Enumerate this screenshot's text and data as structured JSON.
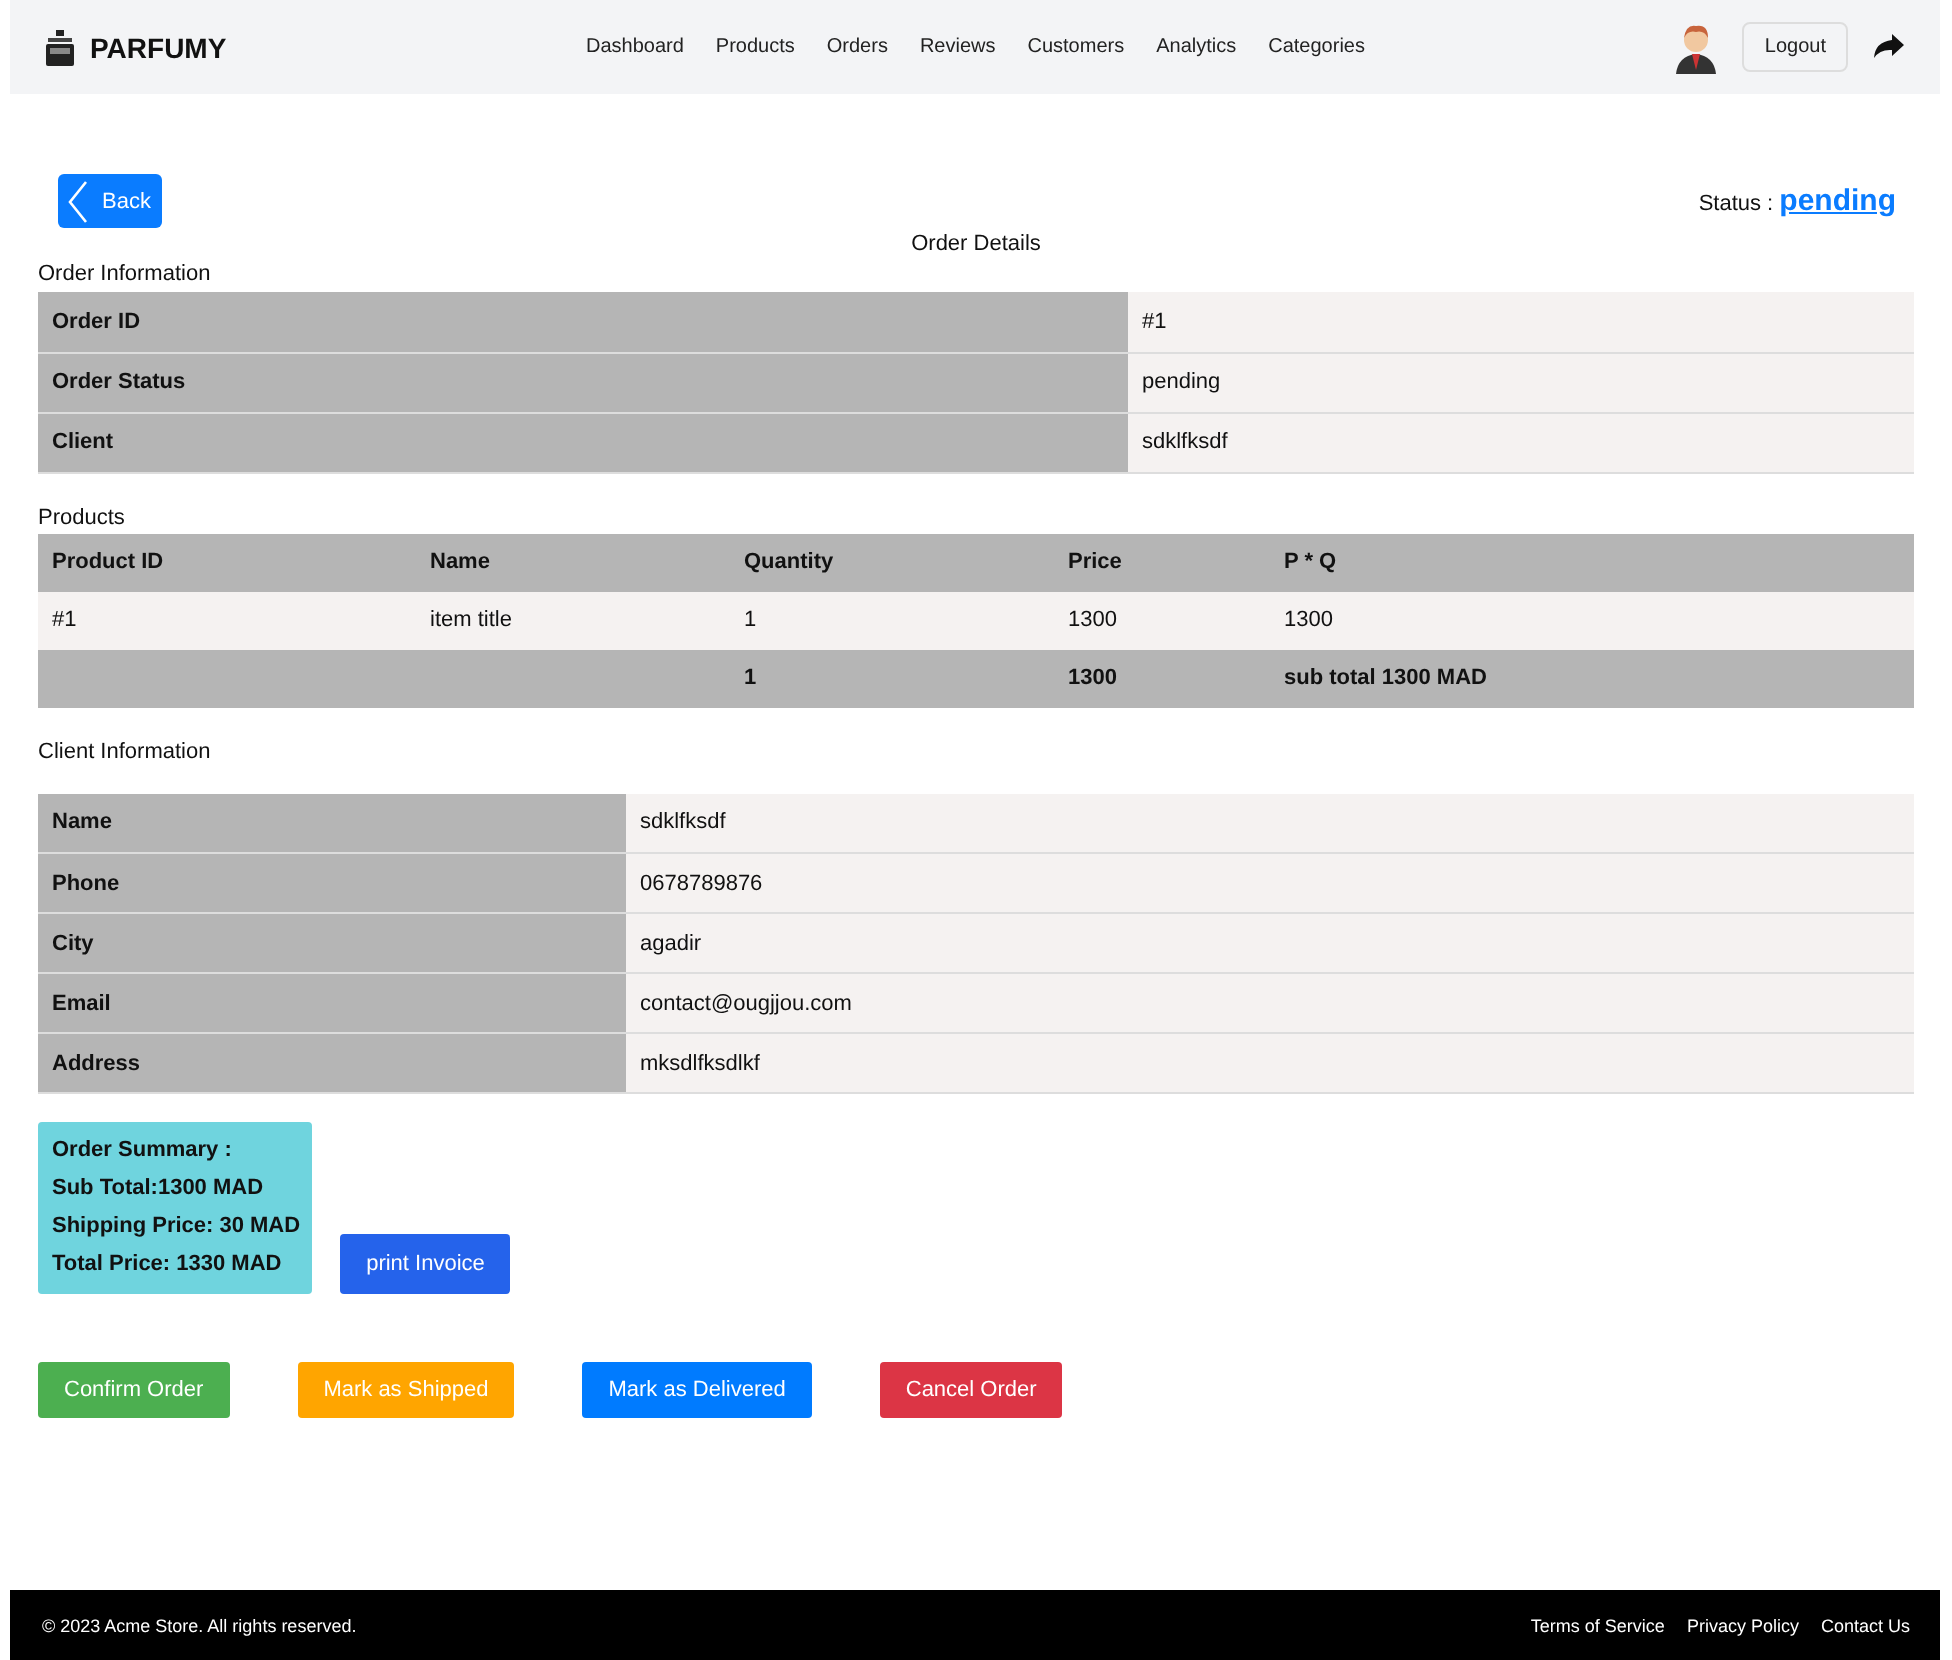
{
  "header": {
    "brand": "PARFUMY",
    "nav": [
      {
        "label": "Dashboard"
      },
      {
        "label": "Products"
      },
      {
        "label": "Orders"
      },
      {
        "label": "Reviews"
      },
      {
        "label": "Customers"
      },
      {
        "label": "Analytics"
      },
      {
        "label": "Categories"
      }
    ],
    "logout": "Logout"
  },
  "back": "Back",
  "status": {
    "label": "Status :",
    "value": "pending"
  },
  "title": "Order Details",
  "order_info": {
    "heading": "Order Information",
    "rows": [
      {
        "label": "Order ID",
        "value": "#1"
      },
      {
        "label": "Order Status",
        "value": "pending"
      },
      {
        "label": "Client",
        "value": "sdklfksdf"
      }
    ]
  },
  "products": {
    "heading": "Products",
    "columns": [
      "Product ID",
      "Name",
      "Quantity",
      "Price",
      "P * Q"
    ],
    "rows": [
      [
        "#1",
        "item title",
        "1",
        "1300",
        "1300"
      ]
    ],
    "total": {
      "quantity": "1",
      "price": "1300",
      "subtotal": "sub total 1300 MAD"
    }
  },
  "client_info": {
    "heading": "Client Information",
    "rows": [
      {
        "label": "Name",
        "value": "sdklfksdf"
      },
      {
        "label": "Phone",
        "value": "0678789876"
      },
      {
        "label": "City",
        "value": "agadir"
      },
      {
        "label": "Email",
        "value": "contact@ougjjou.com"
      },
      {
        "label": "Address",
        "value": "mksdlfksdlkf"
      }
    ]
  },
  "summary": [
    "Order Summary :",
    "Sub Total:1300 MAD",
    "Shipping Price: 30 MAD",
    "Total Price: 1330 MAD"
  ],
  "print_button": "print Invoice",
  "actions": [
    {
      "label": "Confirm Order",
      "color": "#4caf50"
    },
    {
      "label": "Mark as Shipped",
      "color": "#ffa500"
    },
    {
      "label": "Mark as Delivered",
      "color": "#007bff"
    },
    {
      "label": "Cancel Order",
      "color": "#dc3545"
    }
  ],
  "footer": {
    "copyright": "© 2023 Acme Store. All rights reserved.",
    "links": [
      "Terms of Service",
      "Privacy Policy",
      "Contact Us"
    ]
  }
}
